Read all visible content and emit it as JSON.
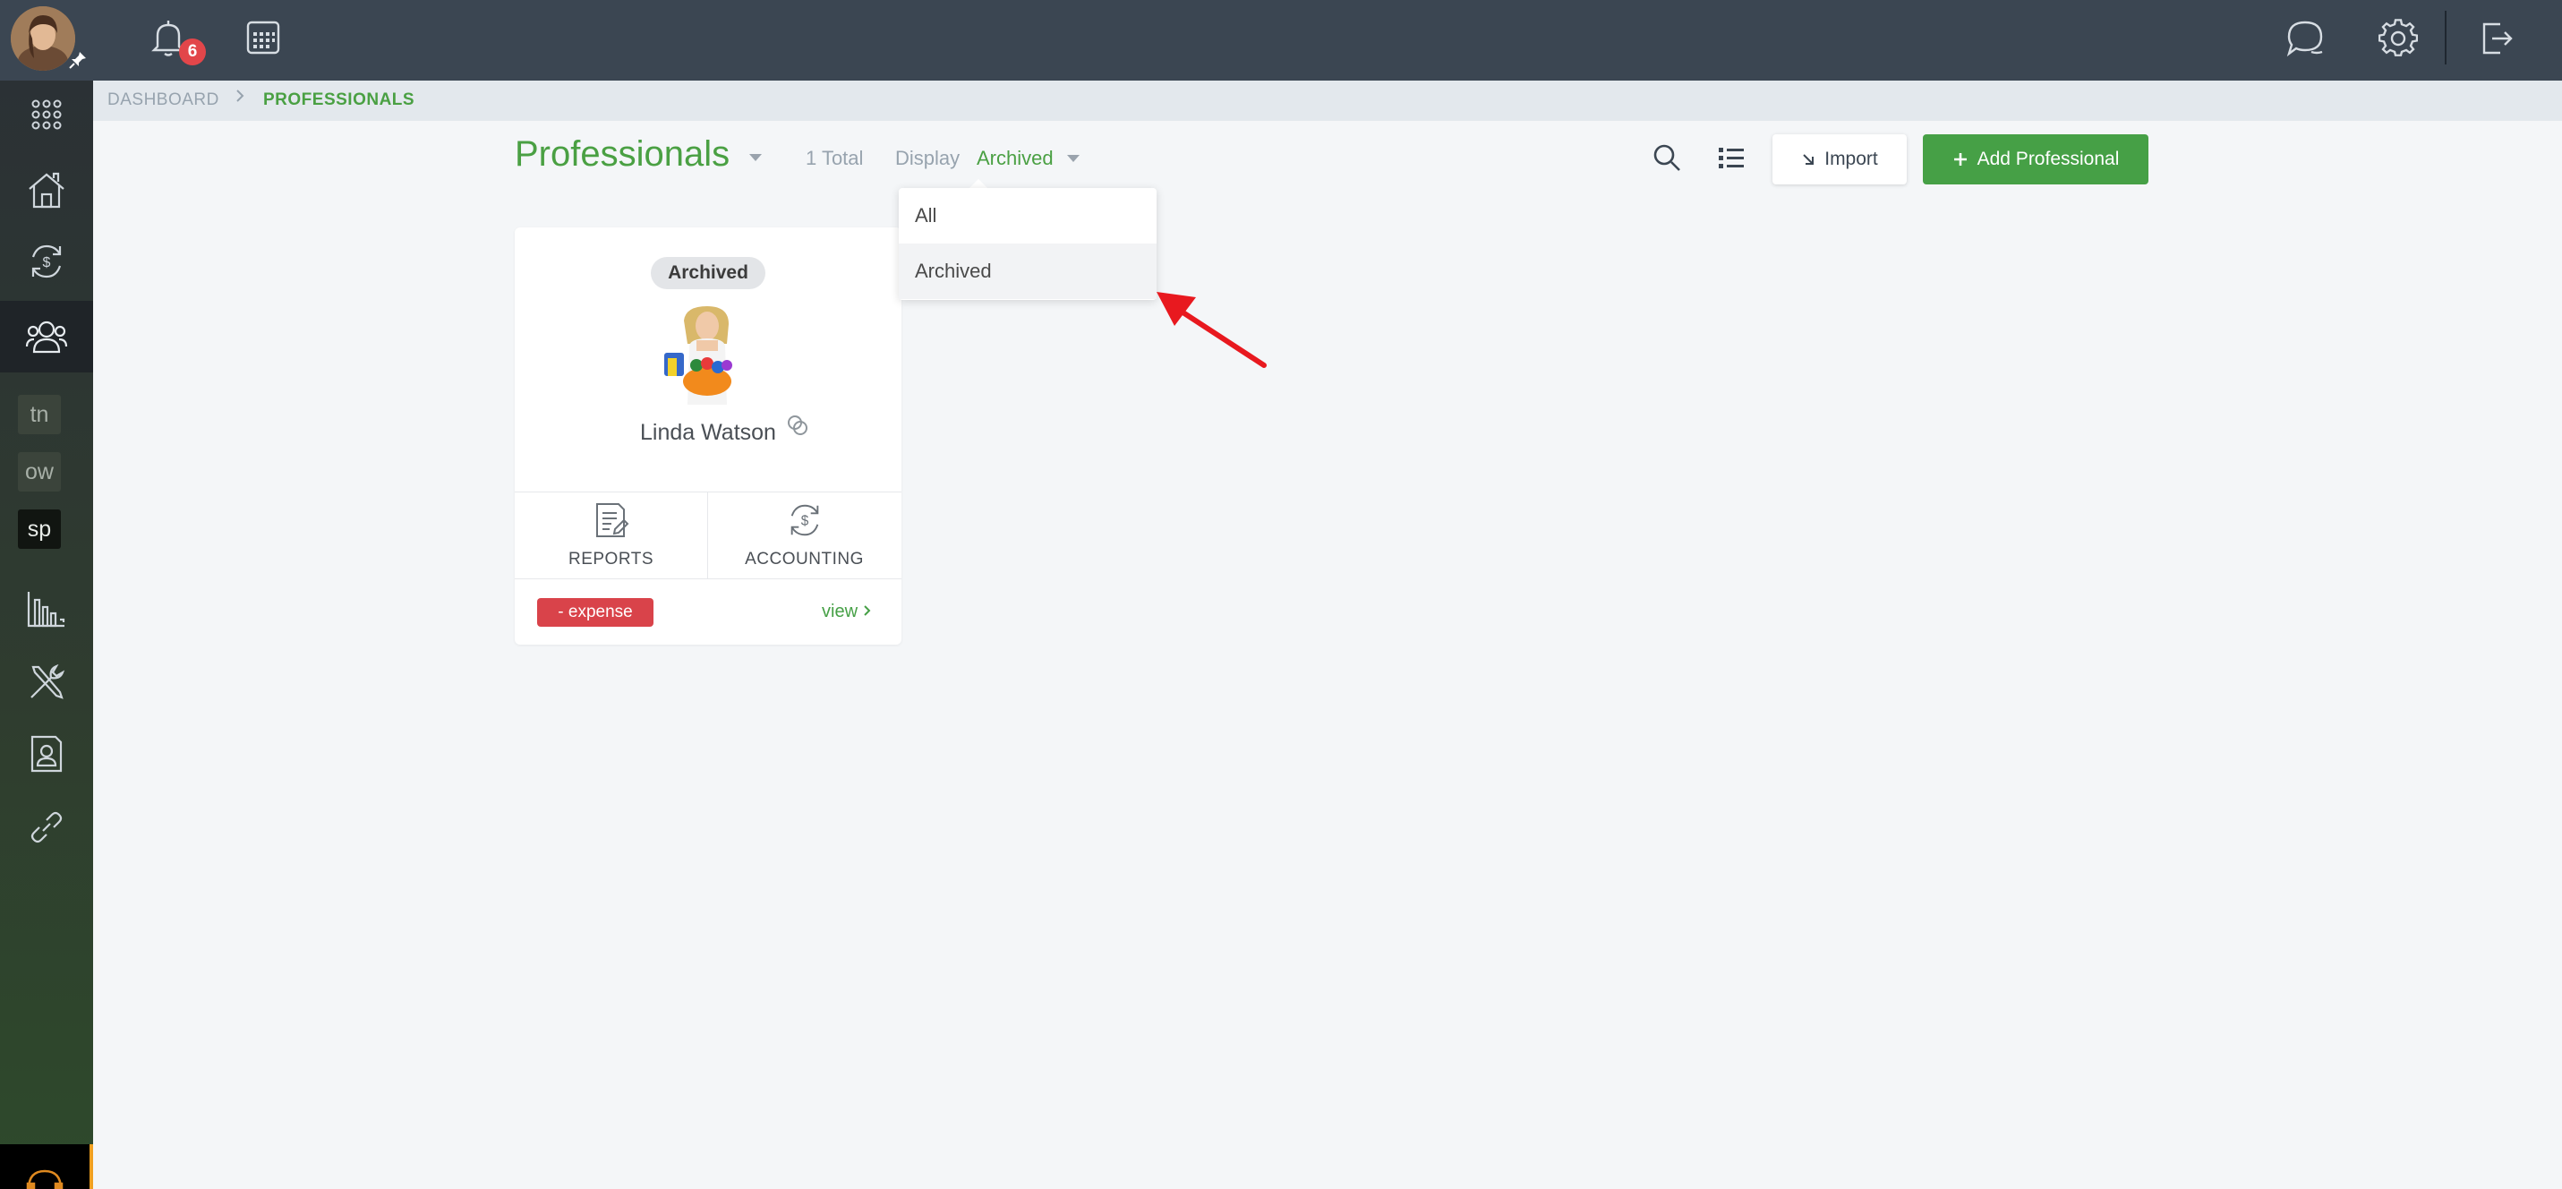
{
  "topbar": {
    "notification_count": "6"
  },
  "sidebar": {
    "tags": [
      "tn",
      "ow",
      "sp"
    ]
  },
  "breadcrumb": {
    "items": [
      "DASHBOARD",
      "PROFESSIONALS"
    ]
  },
  "header": {
    "title": "Professionals",
    "total": "1 Total",
    "display_label": "Display",
    "display_value": "Archived",
    "import_label": "Import",
    "add_label": "Add Professional"
  },
  "dropdown": {
    "options": [
      "All",
      "Archived"
    ],
    "selected": "Archived"
  },
  "card": {
    "status": "Archived",
    "name": "Linda Watson",
    "actions": [
      "REPORTS",
      "ACCOUNTING"
    ],
    "expense_label": "- expense",
    "view_label": "view"
  },
  "colors": {
    "brand_green": "#46a046",
    "topbar": "#3b4652",
    "danger": "#d9434a",
    "annotation_arrow": "#e8191f"
  }
}
